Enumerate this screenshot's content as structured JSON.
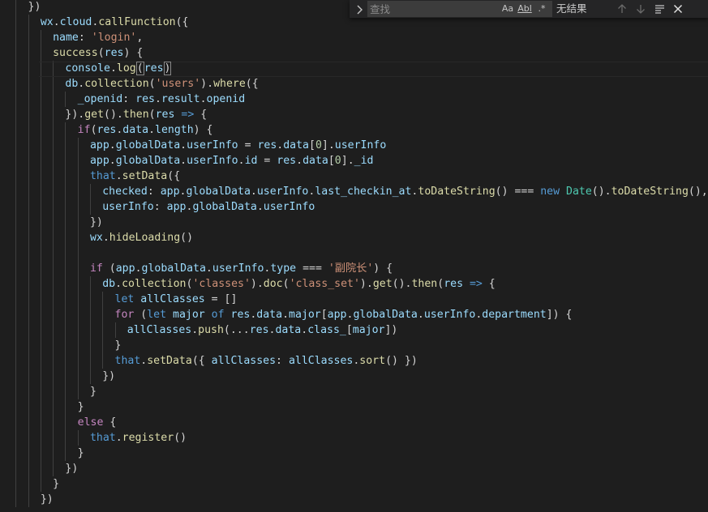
{
  "find_widget": {
    "placeholder": "查找",
    "options": {
      "match_case": "Aa",
      "whole_word": "Abl",
      "regex": ".*"
    },
    "result_text": "无结果",
    "icons": {
      "toggle": "chevron-right-icon",
      "previous": "arrow-up-icon",
      "next": "arrow-down-icon",
      "in_selection": "find-in-selection-icon",
      "close": "close-icon"
    }
  },
  "code_lines": [
    {
      "indent": 2,
      "tokens": [
        {
          "t": "})",
          "c": "punc"
        }
      ]
    },
    {
      "indent": 3,
      "tokens": [
        {
          "t": "wx",
          "c": "var"
        },
        {
          "t": ".",
          "c": "punc"
        },
        {
          "t": "cloud",
          "c": "var"
        },
        {
          "t": ".",
          "c": "punc"
        },
        {
          "t": "callFunction",
          "c": "fn"
        },
        {
          "t": "({",
          "c": "punc"
        }
      ]
    },
    {
      "indent": 4,
      "tokens": [
        {
          "t": "name",
          "c": "var"
        },
        {
          "t": ": ",
          "c": "punc"
        },
        {
          "t": "'login'",
          "c": "str"
        },
        {
          "t": ",",
          "c": "punc"
        }
      ]
    },
    {
      "indent": 4,
      "tokens": [
        {
          "t": "success",
          "c": "fn"
        },
        {
          "t": "(",
          "c": "punc"
        },
        {
          "t": "res",
          "c": "var"
        },
        {
          "t": ") {",
          "c": "punc"
        }
      ]
    },
    {
      "indent": 5,
      "tokens": [
        {
          "t": "console",
          "c": "var"
        },
        {
          "t": ".",
          "c": "punc"
        },
        {
          "t": "log",
          "c": "fn"
        },
        {
          "t": "(",
          "c": "brk"
        },
        {
          "t": "res",
          "c": "var"
        },
        {
          "t": ")",
          "c": "brk"
        }
      ]
    },
    {
      "indent": 5,
      "tokens": [
        {
          "t": "db",
          "c": "var"
        },
        {
          "t": ".",
          "c": "punc"
        },
        {
          "t": "collection",
          "c": "fn"
        },
        {
          "t": "(",
          "c": "punc"
        },
        {
          "t": "'users'",
          "c": "str"
        },
        {
          "t": ").",
          "c": "punc"
        },
        {
          "t": "where",
          "c": "fn"
        },
        {
          "t": "({",
          "c": "punc"
        }
      ]
    },
    {
      "indent": 6,
      "tokens": [
        {
          "t": "_openid",
          "c": "var"
        },
        {
          "t": ": ",
          "c": "punc"
        },
        {
          "t": "res",
          "c": "var"
        },
        {
          "t": ".",
          "c": "punc"
        },
        {
          "t": "result",
          "c": "var"
        },
        {
          "t": ".",
          "c": "punc"
        },
        {
          "t": "openid",
          "c": "var"
        }
      ]
    },
    {
      "indent": 5,
      "tokens": [
        {
          "t": "}).",
          "c": "punc"
        },
        {
          "t": "get",
          "c": "fn"
        },
        {
          "t": "().",
          "c": "punc"
        },
        {
          "t": "then",
          "c": "fn"
        },
        {
          "t": "(",
          "c": "punc"
        },
        {
          "t": "res",
          "c": "var"
        },
        {
          "t": " ",
          "c": "punc"
        },
        {
          "t": "=>",
          "c": "kw"
        },
        {
          "t": " {",
          "c": "punc"
        }
      ]
    },
    {
      "indent": 6,
      "tokens": [
        {
          "t": "if",
          "c": "ctrl"
        },
        {
          "t": "(",
          "c": "punc"
        },
        {
          "t": "res",
          "c": "var"
        },
        {
          "t": ".",
          "c": "punc"
        },
        {
          "t": "data",
          "c": "var"
        },
        {
          "t": ".",
          "c": "punc"
        },
        {
          "t": "length",
          "c": "var"
        },
        {
          "t": ") {",
          "c": "punc"
        }
      ]
    },
    {
      "indent": 7,
      "tokens": [
        {
          "t": "app",
          "c": "var"
        },
        {
          "t": ".",
          "c": "punc"
        },
        {
          "t": "globalData",
          "c": "var"
        },
        {
          "t": ".",
          "c": "punc"
        },
        {
          "t": "userInfo",
          "c": "var"
        },
        {
          "t": " = ",
          "c": "op"
        },
        {
          "t": "res",
          "c": "var"
        },
        {
          "t": ".",
          "c": "punc"
        },
        {
          "t": "data",
          "c": "var"
        },
        {
          "t": "[",
          "c": "punc"
        },
        {
          "t": "0",
          "c": "num"
        },
        {
          "t": "].",
          "c": "punc"
        },
        {
          "t": "userInfo",
          "c": "var"
        }
      ]
    },
    {
      "indent": 7,
      "tokens": [
        {
          "t": "app",
          "c": "var"
        },
        {
          "t": ".",
          "c": "punc"
        },
        {
          "t": "globalData",
          "c": "var"
        },
        {
          "t": ".",
          "c": "punc"
        },
        {
          "t": "userInfo",
          "c": "var"
        },
        {
          "t": ".",
          "c": "punc"
        },
        {
          "t": "id",
          "c": "var"
        },
        {
          "t": " = ",
          "c": "op"
        },
        {
          "t": "res",
          "c": "var"
        },
        {
          "t": ".",
          "c": "punc"
        },
        {
          "t": "data",
          "c": "var"
        },
        {
          "t": "[",
          "c": "punc"
        },
        {
          "t": "0",
          "c": "num"
        },
        {
          "t": "].",
          "c": "punc"
        },
        {
          "t": "_id",
          "c": "var"
        }
      ]
    },
    {
      "indent": 7,
      "tokens": [
        {
          "t": "that",
          "c": "kw"
        },
        {
          "t": ".",
          "c": "punc"
        },
        {
          "t": "setData",
          "c": "fn"
        },
        {
          "t": "({",
          "c": "punc"
        }
      ]
    },
    {
      "indent": 8,
      "tokens": [
        {
          "t": "checked",
          "c": "var"
        },
        {
          "t": ": ",
          "c": "punc"
        },
        {
          "t": "app",
          "c": "var"
        },
        {
          "t": ".",
          "c": "punc"
        },
        {
          "t": "globalData",
          "c": "var"
        },
        {
          "t": ".",
          "c": "punc"
        },
        {
          "t": "userInfo",
          "c": "var"
        },
        {
          "t": ".",
          "c": "punc"
        },
        {
          "t": "last_checkin_at",
          "c": "var"
        },
        {
          "t": ".",
          "c": "punc"
        },
        {
          "t": "toDateString",
          "c": "fn"
        },
        {
          "t": "() === ",
          "c": "op"
        },
        {
          "t": "new",
          "c": "kw"
        },
        {
          "t": " ",
          "c": "punc"
        },
        {
          "t": "Date",
          "c": "cls"
        },
        {
          "t": "().",
          "c": "punc"
        },
        {
          "t": "toDateString",
          "c": "fn"
        },
        {
          "t": "(),",
          "c": "punc"
        }
      ]
    },
    {
      "indent": 8,
      "tokens": [
        {
          "t": "userInfo",
          "c": "var"
        },
        {
          "t": ": ",
          "c": "punc"
        },
        {
          "t": "app",
          "c": "var"
        },
        {
          "t": ".",
          "c": "punc"
        },
        {
          "t": "globalData",
          "c": "var"
        },
        {
          "t": ".",
          "c": "punc"
        },
        {
          "t": "userInfo",
          "c": "var"
        }
      ]
    },
    {
      "indent": 7,
      "tokens": [
        {
          "t": "})",
          "c": "punc"
        }
      ]
    },
    {
      "indent": 7,
      "tokens": [
        {
          "t": "wx",
          "c": "var"
        },
        {
          "t": ".",
          "c": "punc"
        },
        {
          "t": "hideLoading",
          "c": "fn"
        },
        {
          "t": "()",
          "c": "punc"
        }
      ]
    },
    {
      "indent": 7,
      "tokens": []
    },
    {
      "indent": 7,
      "tokens": [
        {
          "t": "if",
          "c": "ctrl"
        },
        {
          "t": " (",
          "c": "punc"
        },
        {
          "t": "app",
          "c": "var"
        },
        {
          "t": ".",
          "c": "punc"
        },
        {
          "t": "globalData",
          "c": "var"
        },
        {
          "t": ".",
          "c": "punc"
        },
        {
          "t": "userInfo",
          "c": "var"
        },
        {
          "t": ".",
          "c": "punc"
        },
        {
          "t": "type",
          "c": "var"
        },
        {
          "t": " === ",
          "c": "op"
        },
        {
          "t": "'副院长'",
          "c": "str"
        },
        {
          "t": ") {",
          "c": "punc"
        }
      ]
    },
    {
      "indent": 8,
      "tokens": [
        {
          "t": "db",
          "c": "var"
        },
        {
          "t": ".",
          "c": "punc"
        },
        {
          "t": "collection",
          "c": "fn"
        },
        {
          "t": "(",
          "c": "punc"
        },
        {
          "t": "'classes'",
          "c": "str"
        },
        {
          "t": ").",
          "c": "punc"
        },
        {
          "t": "doc",
          "c": "fn"
        },
        {
          "t": "(",
          "c": "punc"
        },
        {
          "t": "'class_set'",
          "c": "str"
        },
        {
          "t": ").",
          "c": "punc"
        },
        {
          "t": "get",
          "c": "fn"
        },
        {
          "t": "().",
          "c": "punc"
        },
        {
          "t": "then",
          "c": "fn"
        },
        {
          "t": "(",
          "c": "punc"
        },
        {
          "t": "res",
          "c": "var"
        },
        {
          "t": " ",
          "c": "punc"
        },
        {
          "t": "=>",
          "c": "kw"
        },
        {
          "t": " {",
          "c": "punc"
        }
      ]
    },
    {
      "indent": 9,
      "tokens": [
        {
          "t": "let",
          "c": "kw"
        },
        {
          "t": " ",
          "c": "punc"
        },
        {
          "t": "allClasses",
          "c": "var"
        },
        {
          "t": " = []",
          "c": "op"
        }
      ]
    },
    {
      "indent": 9,
      "tokens": [
        {
          "t": "for",
          "c": "ctrl"
        },
        {
          "t": " (",
          "c": "punc"
        },
        {
          "t": "let",
          "c": "kw"
        },
        {
          "t": " ",
          "c": "punc"
        },
        {
          "t": "major",
          "c": "var"
        },
        {
          "t": " ",
          "c": "punc"
        },
        {
          "t": "of",
          "c": "kw"
        },
        {
          "t": " ",
          "c": "punc"
        },
        {
          "t": "res",
          "c": "var"
        },
        {
          "t": ".",
          "c": "punc"
        },
        {
          "t": "data",
          "c": "var"
        },
        {
          "t": ".",
          "c": "punc"
        },
        {
          "t": "major",
          "c": "var"
        },
        {
          "t": "[",
          "c": "punc"
        },
        {
          "t": "app",
          "c": "var"
        },
        {
          "t": ".",
          "c": "punc"
        },
        {
          "t": "globalData",
          "c": "var"
        },
        {
          "t": ".",
          "c": "punc"
        },
        {
          "t": "userInfo",
          "c": "var"
        },
        {
          "t": ".",
          "c": "punc"
        },
        {
          "t": "department",
          "c": "var"
        },
        {
          "t": "]) {",
          "c": "punc"
        }
      ]
    },
    {
      "indent": 10,
      "tokens": [
        {
          "t": "allClasses",
          "c": "var"
        },
        {
          "t": ".",
          "c": "punc"
        },
        {
          "t": "push",
          "c": "fn"
        },
        {
          "t": "(...",
          "c": "punc"
        },
        {
          "t": "res",
          "c": "var"
        },
        {
          "t": ".",
          "c": "punc"
        },
        {
          "t": "data",
          "c": "var"
        },
        {
          "t": ".",
          "c": "punc"
        },
        {
          "t": "class_",
          "c": "var"
        },
        {
          "t": "[",
          "c": "punc"
        },
        {
          "t": "major",
          "c": "var"
        },
        {
          "t": "])",
          "c": "punc"
        }
      ]
    },
    {
      "indent": 9,
      "tokens": [
        {
          "t": "}",
          "c": "punc"
        }
      ]
    },
    {
      "indent": 9,
      "tokens": [
        {
          "t": "that",
          "c": "kw"
        },
        {
          "t": ".",
          "c": "punc"
        },
        {
          "t": "setData",
          "c": "fn"
        },
        {
          "t": "({ ",
          "c": "punc"
        },
        {
          "t": "allClasses",
          "c": "var"
        },
        {
          "t": ": ",
          "c": "punc"
        },
        {
          "t": "allClasses",
          "c": "var"
        },
        {
          "t": ".",
          "c": "punc"
        },
        {
          "t": "sort",
          "c": "fn"
        },
        {
          "t": "() })",
          "c": "punc"
        }
      ]
    },
    {
      "indent": 8,
      "tokens": [
        {
          "t": "})",
          "c": "punc"
        }
      ]
    },
    {
      "indent": 7,
      "tokens": [
        {
          "t": "}",
          "c": "punc"
        }
      ]
    },
    {
      "indent": 6,
      "tokens": [
        {
          "t": "}",
          "c": "punc"
        }
      ]
    },
    {
      "indent": 6,
      "tokens": [
        {
          "t": "else",
          "c": "ctrl"
        },
        {
          "t": " {",
          "c": "punc"
        }
      ]
    },
    {
      "indent": 7,
      "tokens": [
        {
          "t": "that",
          "c": "kw"
        },
        {
          "t": ".",
          "c": "punc"
        },
        {
          "t": "register",
          "c": "fn"
        },
        {
          "t": "()",
          "c": "punc"
        }
      ]
    },
    {
      "indent": 6,
      "tokens": [
        {
          "t": "}",
          "c": "punc"
        }
      ]
    },
    {
      "indent": 5,
      "tokens": [
        {
          "t": "})",
          "c": "punc"
        }
      ]
    },
    {
      "indent": 4,
      "tokens": [
        {
          "t": "}",
          "c": "punc"
        }
      ]
    },
    {
      "indent": 3,
      "tokens": [
        {
          "t": "})",
          "c": "punc"
        }
      ]
    }
  ]
}
